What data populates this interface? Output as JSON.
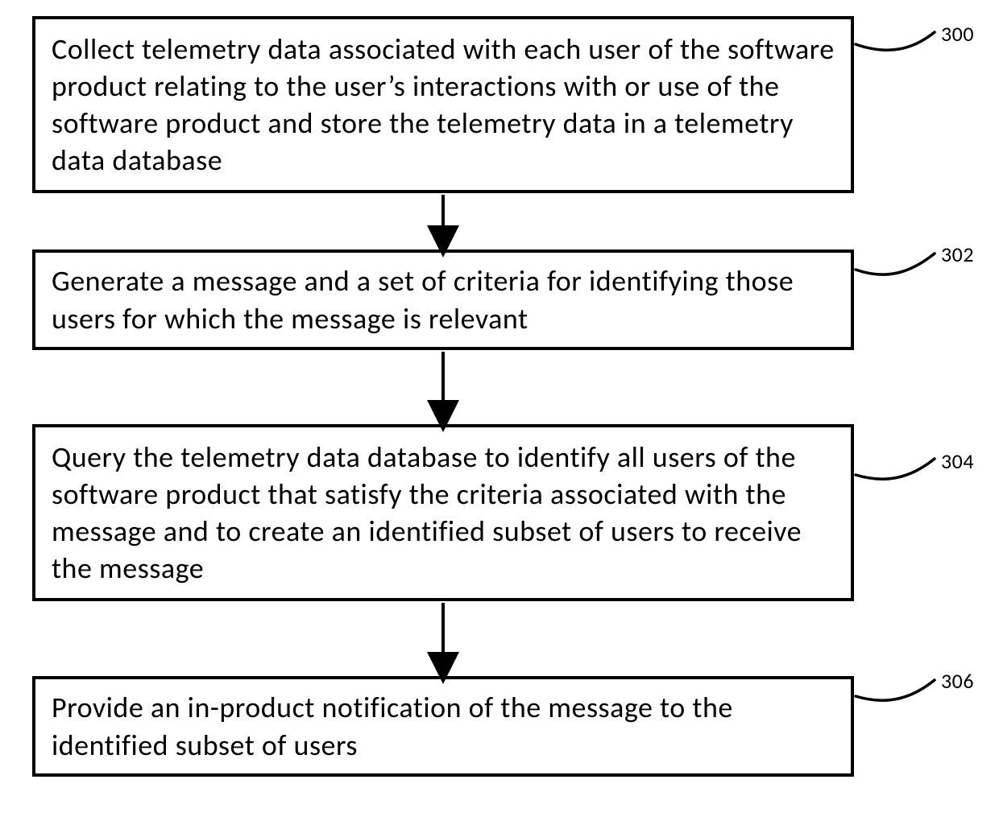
{
  "diagram": {
    "nodes": [
      {
        "id": "n300",
        "text": "Collect telemetry data associated with each user of the software product relating to the user’s interactions with or use of the software product and store the telemetry data in a telemetry data database",
        "ref": "300"
      },
      {
        "id": "n302",
        "text": "Generate a message and a set of criteria for identifying those users for which the message is relevant",
        "ref": "302"
      },
      {
        "id": "n304",
        "text": "Query the telemetry data database to identify all users of the software product that satisfy the criteria associated with the message and to create an identified subset of users to receive the message",
        "ref": "304"
      },
      {
        "id": "n306",
        "text": "Provide an in-product notification of the message to the identified subset of users",
        "ref": "306"
      }
    ],
    "edges": [
      {
        "from": "n300",
        "to": "n302"
      },
      {
        "from": "n302",
        "to": "n304"
      },
      {
        "from": "n304",
        "to": "n306"
      }
    ]
  }
}
